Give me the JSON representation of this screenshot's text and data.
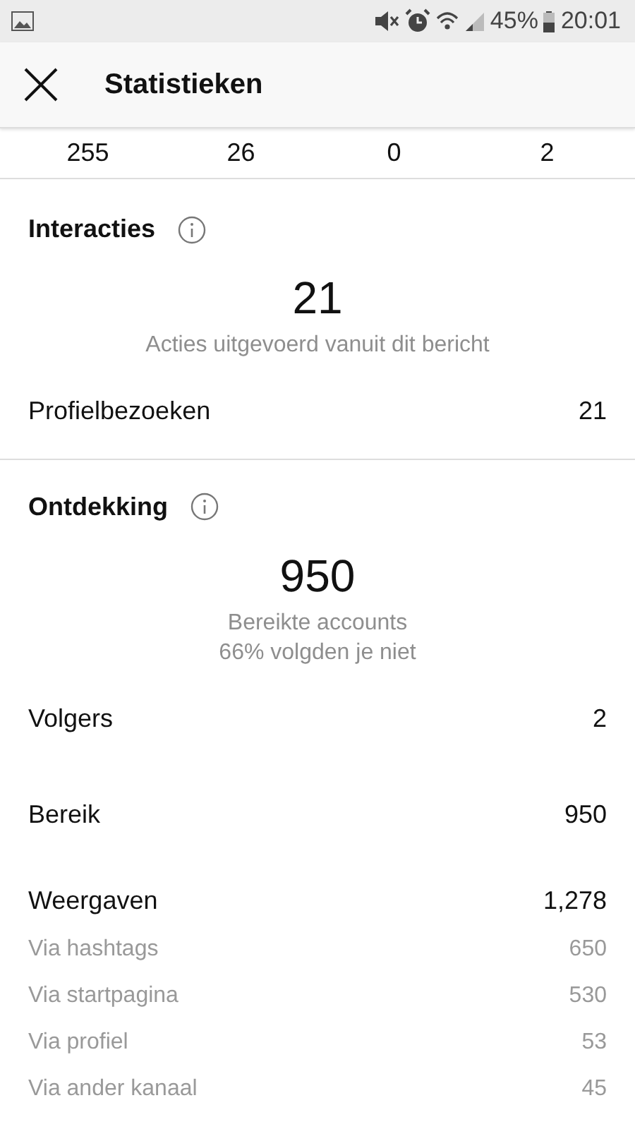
{
  "status_bar": {
    "battery": "45%",
    "time": "20:01"
  },
  "header": {
    "title": "Statistieken"
  },
  "top_numbers": [
    "255",
    "26",
    "0",
    "2"
  ],
  "sections": [
    {
      "title": "Interacties",
      "big_number": "21",
      "captions": [
        "Acties uitgevoerd vanuit dit bericht"
      ],
      "rows": [
        {
          "kind": "main",
          "label": "Profielbezoeken",
          "value": "21"
        }
      ]
    },
    {
      "title": "Ontdekking",
      "big_number": "950",
      "captions": [
        "Bereikte accounts",
        "66% volgden je niet"
      ],
      "rows": [
        {
          "kind": "spaced",
          "label": "Volgers",
          "value": "2"
        },
        {
          "kind": "spaced",
          "label": "Bereik",
          "value": "950"
        },
        {
          "kind": "main",
          "label": "Weergaven",
          "value": "1,278"
        },
        {
          "kind": "sub",
          "label": "Via hashtags",
          "value": "650"
        },
        {
          "kind": "sub",
          "label": "Via startpagina",
          "value": "530"
        },
        {
          "kind": "sub",
          "label": "Via profiel",
          "value": "53"
        },
        {
          "kind": "sub",
          "label": "Via ander kanaal",
          "value": "45"
        }
      ]
    }
  ]
}
